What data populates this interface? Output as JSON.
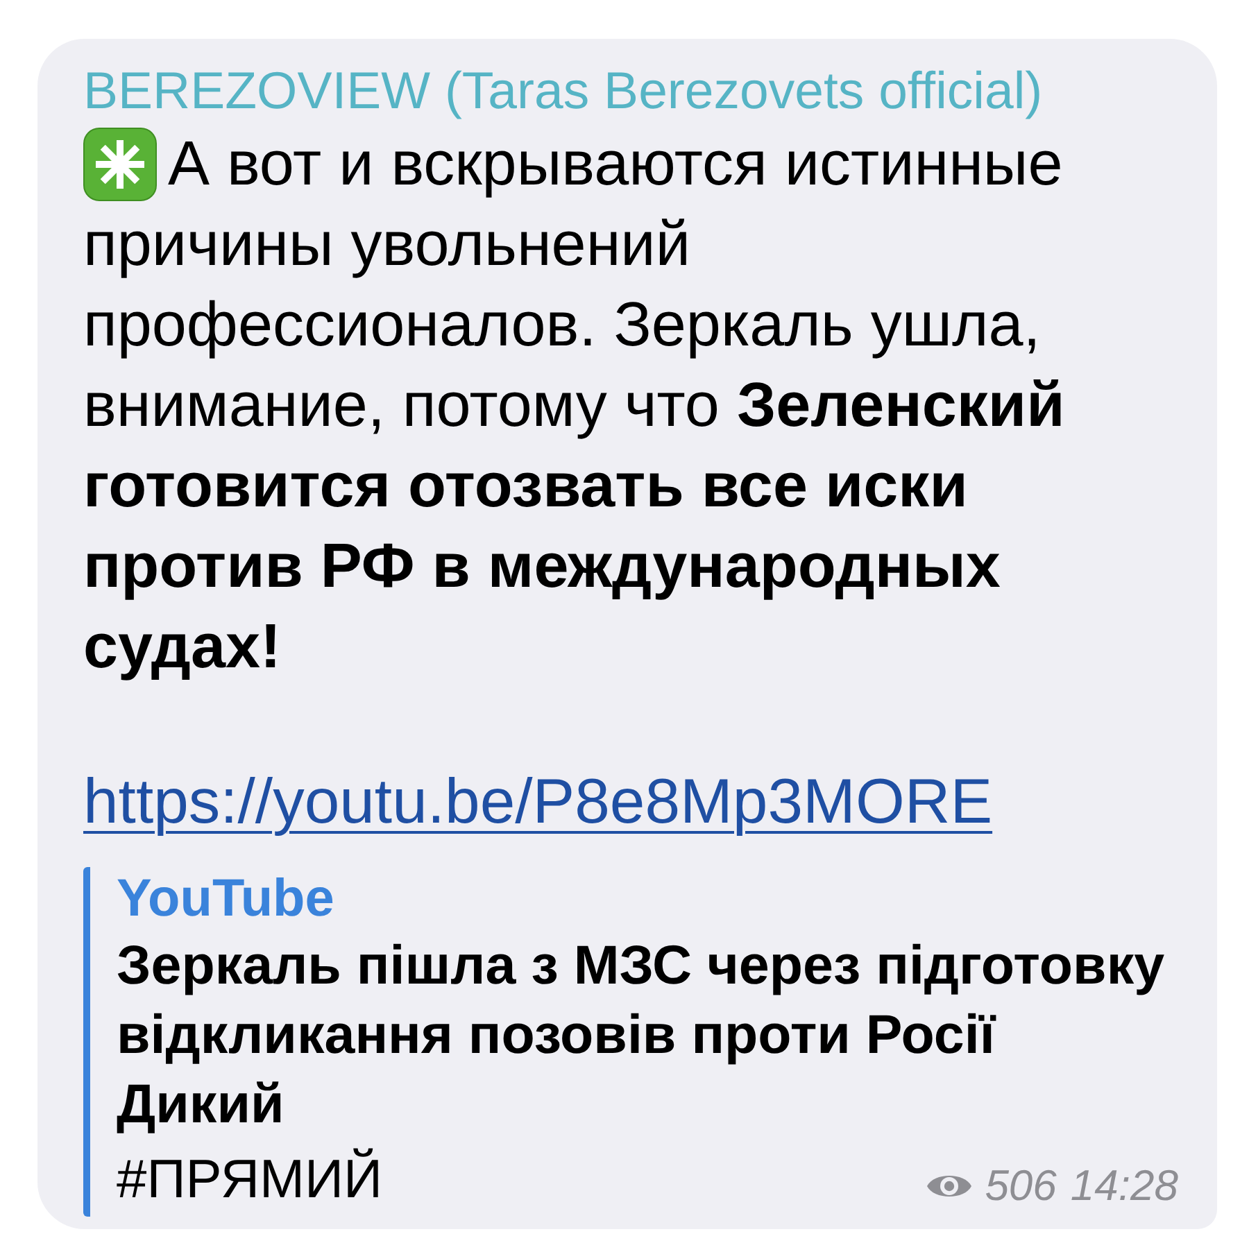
{
  "message": {
    "sender": "BEREZOVIEW (Taras Berezovets official)",
    "text": [
      "А вот и вскрываются истинные",
      "причины увольнений профессионалов. Зеркаль ушла, внимание, потому что **Зеленский готовится отозвать все иски против РФ в международных судах!**"
    ],
    "link": "https://youtu.be/P8e8Mp3MORE",
    "preview": {
      "site": "YouTube",
      "title": "Зеркаль пішла з МЗС через підготовку відкликання позовів проти Росії\nДикий",
      "description": "#ПРЯМИЙ"
    },
    "views": "506",
    "time": "14:28"
  }
}
